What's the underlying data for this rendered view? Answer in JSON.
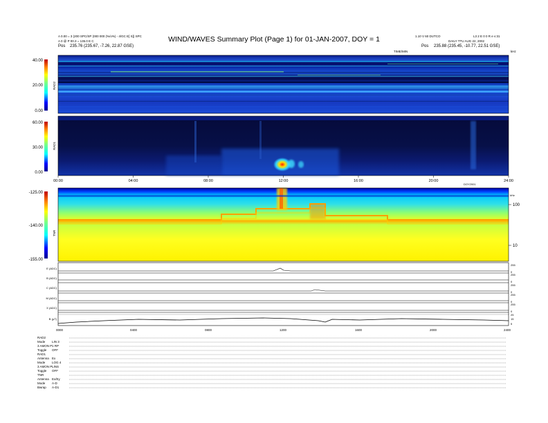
{
  "header": {
    "title": "WIND/WAVES Summary Plot (Page 1) for 01-JAN-2007, DOY = 1",
    "left_line1": "A 0.00 = 3 (200 SPC/SP (000 000 (%/o%) - 4/GC E[ S]) SPC",
    "left_line2": "A 0 @ P 00.3 = 135.0 E C",
    "left_line3_prefix": "Pos",
    "left_line3": "235.76 (235.67, -7.26, 22.87 GSE)",
    "right_line1a": "1.10 V 60 DUTCO",
    "right_line1b": "L3 2 E 0 0 R e v:31",
    "right_line2": "DAILY  TTU AUG 22, 2002",
    "right_line3_prefix": "Pos",
    "right_line3": "235.88 (235.45, -10.77, 22.51 GSE)",
    "rad1_time_label": "TIME/MIN",
    "rad1_units_label": "kHz"
  },
  "panels": {
    "rad2": {
      "label": "RAD2",
      "colorbar_ticks": [
        "40.00",
        "20.00",
        "0.00"
      ]
    },
    "rad1": {
      "label": "RAD1",
      "colorbar_ticks": [
        "60.00",
        "30.00",
        "0.00"
      ]
    },
    "tnr": {
      "label": "TNR",
      "colorbar_ticks": [
        "-125.00",
        "-140.00",
        "-155.00"
      ],
      "right_axis_ticks": [
        "100",
        "10"
      ],
      "right_axis_unit": "kHz"
    }
  },
  "time_axis": {
    "ticks": [
      "00:00",
      "04:00",
      "08:00",
      "12:00",
      "16:00",
      "20:00",
      "24:00"
    ],
    "tnr_tag": "DOY2001"
  },
  "bottom_axis_ticks": [
    "0000",
    "0400",
    "0800",
    "1200",
    "1600",
    "2000",
    "2400"
  ],
  "line_panels": [
    {
      "label": "E (ADC)",
      "ticks": [
        "255",
        "0"
      ]
    },
    {
      "label": "B (ADC)",
      "ticks": [
        "255",
        "0"
      ]
    },
    {
      "label": "C (ADC)",
      "ticks": [
        "255",
        "0"
      ]
    },
    {
      "label": "M (ADC)",
      "ticks": [
        "255",
        "0"
      ]
    },
    {
      "label": "X (ADC)",
      "ticks": [
        "255",
        "0"
      ]
    },
    {
      "label": "B (μT)",
      "ticks": [
        "25",
        "15",
        "5"
      ]
    }
  ],
  "footer": {
    "rows": [
      {
        "k": "RAD2",
        "v": ""
      },
      {
        "k": "Mode",
        "v": "LIN 3"
      },
      {
        "k": "3 AMON P",
        "v": "1 RP"
      },
      {
        "k": "Toggle",
        "v": "OFF"
      },
      {
        "k": "RAD1",
        "v": ""
      },
      {
        "k": "Antenna",
        "v": "Ex"
      },
      {
        "k": "Mode",
        "v": "LOG 4"
      },
      {
        "k": "3 AMON P",
        "v": "LINS"
      },
      {
        "k": "Toggle",
        "v": "OFF"
      },
      {
        "k": "TNR",
        "v": ""
      },
      {
        "k": "Antenna",
        "v": "Ex/Ey"
      },
      {
        "k": "Mode",
        "v": "A-D"
      },
      {
        "k": "Bwrap",
        "v": "A-D1"
      }
    ]
  },
  "chart_data": {
    "type": "heatmap",
    "title": "WIND/WAVES Summary Plot (Page 1) for 01-JAN-2007, DOY = 1",
    "x_range_hours": [
      0,
      24
    ],
    "panels": [
      {
        "name": "RAD2",
        "colorbar_range": [
          0,
          40
        ]
      },
      {
        "name": "RAD1",
        "colorbar_range": [
          0,
          60
        ]
      },
      {
        "name": "TNR",
        "colorbar_range": [
          -155,
          -125
        ]
      }
    ],
    "events": [
      {
        "panel": "RAD1",
        "time_hours": 12.0,
        "intensity": "peak"
      },
      {
        "panel": "TNR",
        "time_hours": 12.0,
        "intensity": "high"
      },
      {
        "panel": "TNR",
        "time_hours": 14.0,
        "intensity": "medium"
      }
    ]
  }
}
